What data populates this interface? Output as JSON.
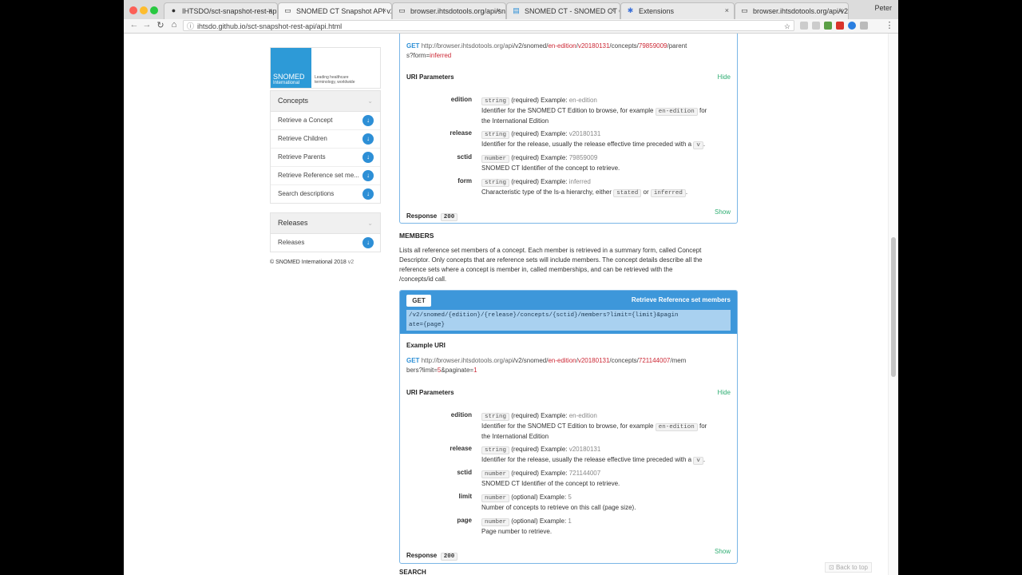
{
  "browser": {
    "tabs": [
      {
        "title": "IHTSDO/sct-snapshot-rest-api",
        "icon": "github-icon"
      },
      {
        "title": "SNOMED CT Snapshot API v2",
        "icon": "document-icon"
      },
      {
        "title": "browser.ihtsdotools.org/api/sn",
        "icon": "document-icon"
      },
      {
        "title": "SNOMED CT - SNOMED CT Co",
        "icon": "snomed-icon"
      },
      {
        "title": "Extensions",
        "icon": "puzzle-icon"
      },
      {
        "title": "browser.ihtsdotools.org/api/v2",
        "icon": "document-icon"
      }
    ],
    "profile": "Peter",
    "url": "ihtsdo.github.io/sct-snapshot-rest-api/api.html"
  },
  "sidebar": {
    "logo": {
      "title": "SNOMED",
      "subtitle": "International",
      "tagline1": "Leading healthcare",
      "tagline2": "terminology, worldwide"
    },
    "concepts": {
      "heading": "Concepts",
      "items": [
        "Retrieve a Concept",
        "Retrieve Children",
        "Retrieve Parents",
        "Retrieve Reference set me...",
        "Search descriptions"
      ]
    },
    "releases": {
      "heading": "Releases",
      "items": [
        "Releases"
      ]
    },
    "copyright": "© SNOMED International 2018",
    "version": "v2"
  },
  "parents_card": {
    "uri": {
      "method": "GET",
      "host": "http://browser.ihtsdotools.org/api",
      "path1": "/v2/snomed/",
      "edition": "en-edition",
      "slash1": "/",
      "release": "v20180131",
      "path2": "/concepts/",
      "sctid": "79859009",
      "path3": "/parent",
      "line2a": "s?form=",
      "form": "inferred"
    },
    "uri_params_label": "URI Parameters",
    "hide_label": "Hide",
    "params": [
      {
        "name": "edition",
        "type": "string",
        "req": "(required) Example:",
        "example": "en-edition",
        "desc_a": "Identifier for the SNOMED CT Edition to browse, for example",
        "code": "en-edition",
        "desc_b": "for",
        "desc_c": "the International Edition"
      },
      {
        "name": "release",
        "type": "string",
        "req": "(required) Example:",
        "example": "v20180131",
        "desc_a": "Identifier for the release, usually the release effective time preceded with a",
        "code": "v",
        "desc_b": "."
      },
      {
        "name": "sctid",
        "type": "number",
        "req": "(required) Example:",
        "example": "79859009",
        "desc_a": "SNOMED CT Identifier of the concept to retrieve."
      },
      {
        "name": "form",
        "type": "string",
        "req": "(required) Example:",
        "example": "inferred",
        "desc_a": "Characteristic type of the Is-a hierarchy, either",
        "code": "stated",
        "desc_b": "or",
        "code2": "inferred",
        "desc_c": "."
      }
    ],
    "response_label": "Response",
    "response_code": "200",
    "show_label": "Show"
  },
  "members": {
    "heading": "MEMBERS",
    "description": [
      "Lists all reference set members of a concept. Each member is retrieved in a summary form, called Concept",
      "Descriptor. Only concepts that are reference sets will include members. The concept details describe all the",
      "reference sets where a concept is member in, called memberships, and can be retrieved with the",
      "/concepts/id call."
    ],
    "method": "GET",
    "title": "Retrieve Reference set members",
    "template_uri": [
      "/v2/snomed/{edition}/{release}/concepts/{sctid}/members?limit={limit}&pagin",
      "ate={page}"
    ],
    "example_label": "Example URI",
    "uri": {
      "method": "GET",
      "host": "http://browser.ihtsdotools.org/api",
      "path1": "/v2/snomed/",
      "edition": "en-edition",
      "slash1": "/",
      "release": "v20180131",
      "path2": "/concepts/",
      "sctid": "721144007",
      "path3": "/mem",
      "line2a": "bers?limit=",
      "limit": "5",
      "line2b": "&paginate=",
      "page": "1"
    },
    "uri_params_label": "URI Parameters",
    "hide_label": "Hide",
    "params": [
      {
        "name": "edition",
        "type": "string",
        "req": "(required) Example:",
        "example": "en-edition",
        "desc_a": "Identifier for the SNOMED CT Edition to browse, for example",
        "code": "en-edition",
        "desc_b": "for",
        "desc_c": "the International Edition"
      },
      {
        "name": "release",
        "type": "string",
        "req": "(required) Example:",
        "example": "v20180131",
        "desc_a": "Identifier for the release, usually the release effective time preceded with a",
        "code": "v",
        "desc_b": "."
      },
      {
        "name": "sctid",
        "type": "number",
        "req": "(required) Example:",
        "example": "721144007",
        "desc_a": "SNOMED CT Identifier of the concept to retrieve."
      },
      {
        "name": "limit",
        "type": "number",
        "req": "(optional) Example:",
        "example": "5",
        "desc_a": "Number of concepts to retrieve on this call (page size)."
      },
      {
        "name": "page",
        "type": "number",
        "req": "(optional) Example:",
        "example": "1",
        "desc_a": "Page number to retrieve."
      }
    ],
    "response_label": "Response",
    "response_code": "200",
    "show_label": "Show"
  },
  "next_section": "SEARCH",
  "back_to_top": "Back to top"
}
